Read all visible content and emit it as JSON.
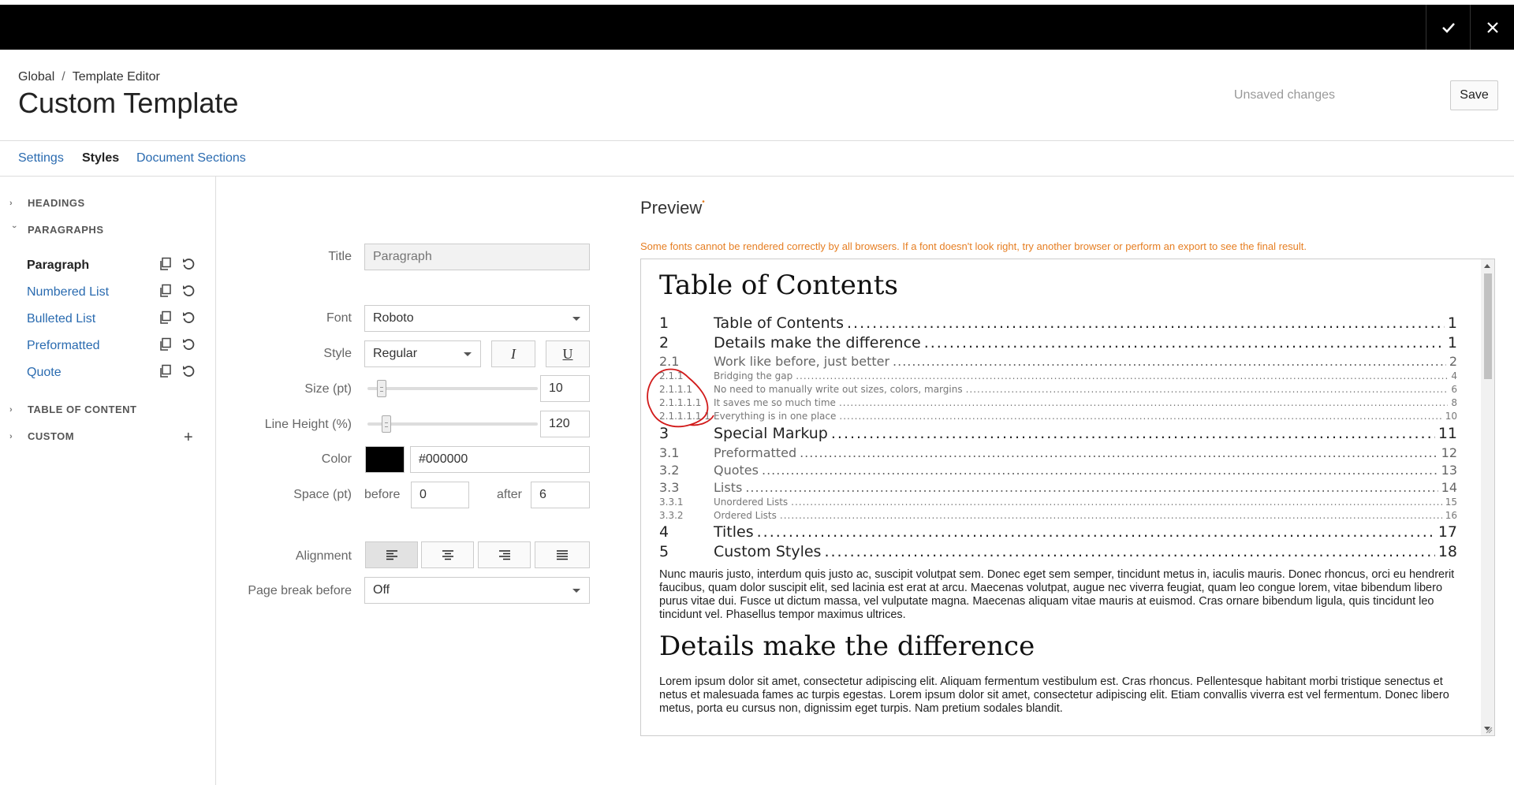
{
  "window": {
    "confirm_icon": "check-icon",
    "close_icon": "close-icon"
  },
  "header": {
    "breadcrumb": [
      "Global",
      "Template Editor"
    ],
    "breadcrumb_separator": "/",
    "title": "Custom Template",
    "status": "Unsaved changes",
    "save_label": "Save"
  },
  "tabs": [
    {
      "label": "Settings",
      "active": false
    },
    {
      "label": "Styles",
      "active": true
    },
    {
      "label": "Document Sections",
      "active": false
    }
  ],
  "sidebar": {
    "sections": [
      {
        "label": "HEADINGS",
        "expanded": false
      },
      {
        "label": "PARAGRAPHS",
        "expanded": true
      },
      {
        "label": "TABLE OF CONTENT",
        "expanded": false
      },
      {
        "label": "CUSTOM",
        "expanded": false
      }
    ],
    "paragraph_items": [
      {
        "label": "Paragraph",
        "active": true
      },
      {
        "label": "Numbered List",
        "active": false
      },
      {
        "label": "Bulleted List",
        "active": false
      },
      {
        "label": "Preformatted",
        "active": false
      },
      {
        "label": "Quote",
        "active": false
      }
    ]
  },
  "form": {
    "title_label": "Title",
    "title_placeholder": "Paragraph",
    "font_label": "Font",
    "font_value": "Roboto",
    "style_label": "Style",
    "style_value": "Regular",
    "italic_label": "I",
    "underline_label": "U",
    "size_label": "Size (pt)",
    "size_value": "10",
    "line_height_label": "Line Height (%)",
    "line_height_value": "120",
    "color_label": "Color",
    "color_value": "#000000",
    "space_label": "Space (pt)",
    "before_label": "before",
    "before_value": "0",
    "after_label": "after",
    "after_value": "6",
    "alignment_label": "Alignment",
    "alignment_selected": "left",
    "page_break_label": "Page break before",
    "page_break_value": "Off"
  },
  "preview": {
    "title": "Preview",
    "warning": "Some fonts cannot be rendered correctly by all browsers. If a font doesn't look right, try another browser or perform an export to see the final result.",
    "toc_heading": "Table of Contents",
    "toc": [
      {
        "num": "1",
        "text": "Table of Contents",
        "page": "1",
        "level": 1
      },
      {
        "num": "2",
        "text": "Details make the difference",
        "page": "1",
        "level": 1
      },
      {
        "num": "2.1",
        "text": "Work like before, just better",
        "page": "2",
        "level": 2
      },
      {
        "num": "2.1.1",
        "text": "Bridging the gap",
        "page": "4",
        "level": 3
      },
      {
        "num": "2.1.1.1",
        "text": "No need to manually write out sizes, colors, margins",
        "page": "6",
        "level": 3
      },
      {
        "num": "2.1.1.1.1",
        "text": "It saves me so much time",
        "page": "8",
        "level": 3
      },
      {
        "num": "2.1.1.1.1.1",
        "text": "Everything is in one place",
        "page": "10",
        "level": 3
      },
      {
        "num": "3",
        "text": "Special Markup",
        "page": "11",
        "level": 1
      },
      {
        "num": "3.1",
        "text": "Preformatted",
        "page": "12",
        "level": 2
      },
      {
        "num": "3.2",
        "text": "Quotes",
        "page": "13",
        "level": 2
      },
      {
        "num": "3.3",
        "text": "Lists",
        "page": "14",
        "level": 2
      },
      {
        "num": "3.3.1",
        "text": "Unordered Lists",
        "page": "15",
        "level": 3
      },
      {
        "num": "3.3.2",
        "text": "Ordered Lists",
        "page": "16",
        "level": 3
      },
      {
        "num": "4",
        "text": "Titles",
        "page": "17",
        "level": 1
      },
      {
        "num": "5",
        "text": "Custom Styles",
        "page": "18",
        "level": 1
      }
    ],
    "paragraph1": "Nunc mauris justo, interdum quis justo ac, suscipit volutpat sem. Donec eget sem semper, tincidunt metus in, iaculis mauris. Donec rhoncus, orci eu hendrerit faucibus, quam dolor suscipit elit, sed lacinia est erat at arcu. Maecenas volutpat, augue nec viverra feugiat, quam leo congue lorem, vitae bibendum libero purus vitae dui. Fusce ut dictum massa, vel vulputate magna. Maecenas aliquam vitae mauris at euismod. Cras ornare bibendum ligula, quis tincidunt leo tincidunt vel. Phasellus tempor maximus ultrices.",
    "heading2": "Details make the difference",
    "paragraph2": "Lorem ipsum dolor sit amet, consectetur adipiscing elit. Aliquam fermentum vestibulum est. Cras rhoncus. Pellentesque habitant morbi tristique senectus et netus et malesuada fames ac turpis egestas.  Lorem ipsum dolor sit amet, consectetur adipiscing elit. Etiam convallis viverra est vel fermentum. Donec libero metus, porta eu cursus non, dignissim eget turpis. Nam pretium sodales blandit."
  },
  "colors": {
    "link": "#2a6bb0",
    "warning": "#e67e22",
    "annotation": "#d11a1a",
    "topbar": "#000000"
  }
}
